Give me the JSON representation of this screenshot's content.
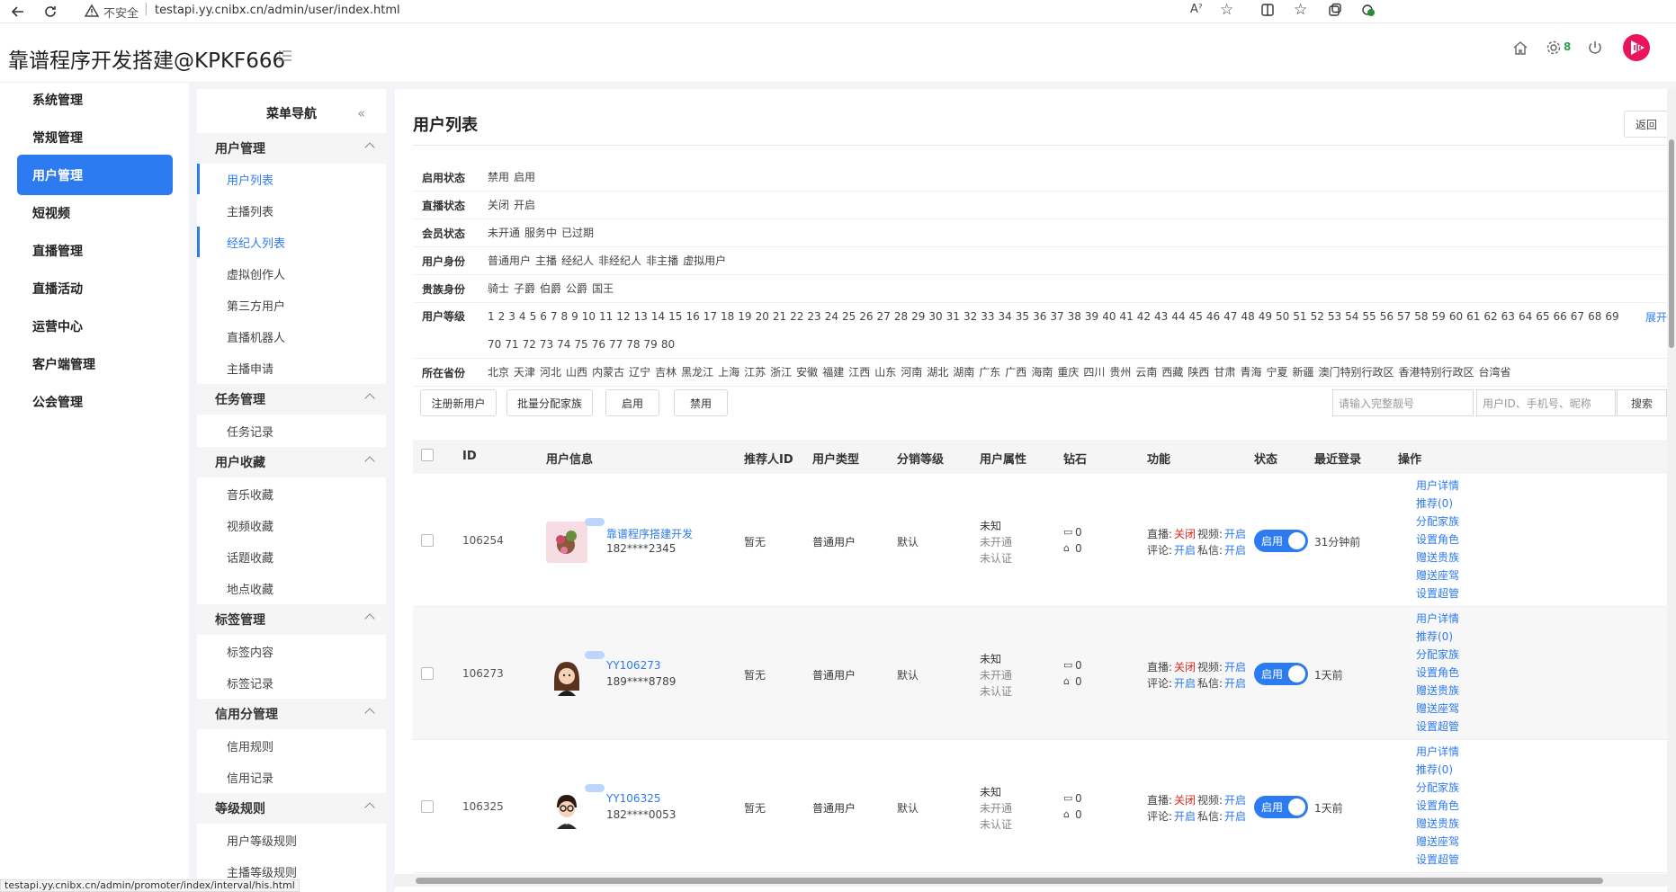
{
  "browser": {
    "security_label": "不安全",
    "url": "testapi.yy.cnibx.cn/admin/user/index.html",
    "settings_badge": "8",
    "status_url": "testapi.yy.cnibx.cn/admin/promoter/index/interval/his.html"
  },
  "header": {
    "title": "靠谱程序开发搭建@KPKF666",
    "settings_count": "8"
  },
  "main_nav": [
    {
      "label": "系统管理"
    },
    {
      "label": "常规管理"
    },
    {
      "label": "用户管理",
      "active": true
    },
    {
      "label": "短视频"
    },
    {
      "label": "直播管理"
    },
    {
      "label": "直播活动"
    },
    {
      "label": "运营中心"
    },
    {
      "label": "客户端管理"
    },
    {
      "label": "公会管理"
    }
  ],
  "submenu": {
    "title": "菜单导航",
    "groups": [
      {
        "label": "用户管理",
        "items": [
          "用户列表",
          "主播列表",
          "经纪人列表",
          "虚拟创作人",
          "第三方用户",
          "直播机器人",
          "主播申请"
        ]
      },
      {
        "label": "任务管理",
        "items": [
          "任务记录"
        ]
      },
      {
        "label": "用户收藏",
        "items": [
          "音乐收藏",
          "视频收藏",
          "话题收藏",
          "地点收藏"
        ]
      },
      {
        "label": "标签管理",
        "items": [
          "标签内容",
          "标签记录"
        ]
      },
      {
        "label": "信用分管理",
        "items": [
          "信用规则",
          "信用记录"
        ]
      },
      {
        "label": "等级规则",
        "items": [
          "用户等级规则",
          "主播等级规则"
        ]
      }
    ]
  },
  "page": {
    "title": "用户列表",
    "back_label": "返回"
  },
  "filters": [
    {
      "label": "启用状态",
      "options": [
        "禁用",
        "启用"
      ]
    },
    {
      "label": "直播状态",
      "options": [
        "关闭",
        "开启"
      ]
    },
    {
      "label": "会员状态",
      "options": [
        "未开通",
        "服务中",
        "已过期"
      ]
    },
    {
      "label": "用户身份",
      "options": [
        "普通用户",
        "主播",
        "经纪人",
        "非经纪人",
        "非主播",
        "虚拟用户"
      ]
    },
    {
      "label": "贵族身份",
      "options": [
        "骑士",
        "子爵",
        "伯爵",
        "公爵",
        "国王"
      ]
    },
    {
      "label": "用户等级",
      "options": [
        "1",
        "2",
        "3",
        "4",
        "5",
        "6",
        "7",
        "8",
        "9",
        "10",
        "11",
        "12",
        "13",
        "14",
        "15",
        "16",
        "17",
        "18",
        "19",
        "20",
        "21",
        "22",
        "23",
        "24",
        "25",
        "26",
        "27",
        "28",
        "29",
        "30",
        "31",
        "32",
        "33",
        "34",
        "35",
        "36",
        "37",
        "38",
        "39",
        "40",
        "41",
        "42",
        "43",
        "44",
        "45",
        "46",
        "47",
        "48",
        "49",
        "50",
        "51",
        "52",
        "53",
        "54",
        "55",
        "56",
        "57",
        "58",
        "59",
        "60",
        "61",
        "62",
        "63",
        "64",
        "65",
        "66",
        "67",
        "68",
        "69",
        "70",
        "71",
        "72",
        "73",
        "74",
        "75",
        "76",
        "77",
        "78",
        "79",
        "80"
      ],
      "expand": "展开"
    },
    {
      "label": "所在省份",
      "options": [
        "北京",
        "天津",
        "河北",
        "山西",
        "内蒙古",
        "辽宁",
        "吉林",
        "黑龙江",
        "上海",
        "江苏",
        "浙江",
        "安徽",
        "福建",
        "江西",
        "山东",
        "河南",
        "湖北",
        "湖南",
        "广东",
        "广西",
        "海南",
        "重庆",
        "四川",
        "贵州",
        "云南",
        "西藏",
        "陕西",
        "甘肃",
        "青海",
        "宁夏",
        "新疆",
        "澳门特别行政区",
        "香港特别行政区",
        "台湾省"
      ]
    }
  ],
  "toolbar": {
    "register": "注册新用户",
    "assign_family": "批量分配家族",
    "enable": "启用",
    "disable": "禁用",
    "account_placeholder": "请输入完整靓号",
    "search_placeholder": "用户ID、手机号、昵称",
    "search": "搜索"
  },
  "table": {
    "columns": [
      "ID",
      "用户信息",
      "推荐人ID",
      "用户类型",
      "分销等级",
      "用户属性",
      "钻石",
      "功能",
      "状态",
      "最近登录",
      "操作"
    ],
    "rows": [
      {
        "id": "106254",
        "name": "靠谱程序搭建开发",
        "phone": "182****2345",
        "referrer": "暂无",
        "type": "普通用户",
        "level": "默认",
        "attr1": "未知",
        "attr2": "未开通",
        "attr3": "未认证",
        "diamond1": "0",
        "diamond2": "0",
        "live_label": "直播:",
        "live": "关闭",
        "video_label": "视频:",
        "video": "开启",
        "comment_label": "评论:",
        "comment": "开启",
        "msg_label": "私信:",
        "msg": "开启",
        "status": "启用",
        "last_login": "31分钟前",
        "ops": [
          "用户详情",
          "推荐(0)",
          "分配家族",
          "设置角色",
          "赠送贵族",
          "赠送座驾",
          "设置超管"
        ]
      },
      {
        "id": "106273",
        "name": "YY106273",
        "phone": "189****8789",
        "referrer": "暂无",
        "type": "普通用户",
        "level": "默认",
        "attr1": "未知",
        "attr2": "未开通",
        "attr3": "未认证",
        "diamond1": "0",
        "diamond2": "0",
        "live_label": "直播:",
        "live": "关闭",
        "video_label": "视频:",
        "video": "开启",
        "comment_label": "评论:",
        "comment": "开启",
        "msg_label": "私信:",
        "msg": "开启",
        "status": "启用",
        "last_login": "1天前",
        "ops": [
          "用户详情",
          "推荐(0)",
          "分配家族",
          "设置角色",
          "赠送贵族",
          "赠送座驾",
          "设置超管"
        ]
      },
      {
        "id": "106325",
        "name": "YY106325",
        "phone": "182****0053",
        "referrer": "暂无",
        "type": "普通用户",
        "level": "默认",
        "attr1": "未知",
        "attr2": "未开通",
        "attr3": "未认证",
        "diamond1": "0",
        "diamond2": "0",
        "live_label": "直播:",
        "live": "关闭",
        "video_label": "视频:",
        "video": "开启",
        "comment_label": "评论:",
        "comment": "开启",
        "msg_label": "私信:",
        "msg": "开启",
        "status": "启用",
        "last_login": "1天前",
        "ops": [
          "用户详情",
          "推荐(0)",
          "分配家族",
          "设置角色",
          "赠送贵族",
          "赠送座驾",
          "设置超管"
        ]
      }
    ]
  },
  "colors": {
    "accent": "#2d7bf0",
    "danger": "#e0251b",
    "brand_logo": "#e8155c"
  },
  "icons": [
    "back-arrow-icon",
    "reload-icon",
    "warning-icon",
    "read-aloud-icon",
    "favorite-star-icon",
    "split-screen-icon",
    "favorites-icon",
    "collections-icon",
    "extensions-icon",
    "menu-list-icon",
    "home-icon",
    "gear-icon",
    "power-icon",
    "brand-logo-icon",
    "collapse-icon",
    "chevron-up-icon",
    "checkbox-icon",
    "diamond-icon",
    "lock-icon"
  ]
}
